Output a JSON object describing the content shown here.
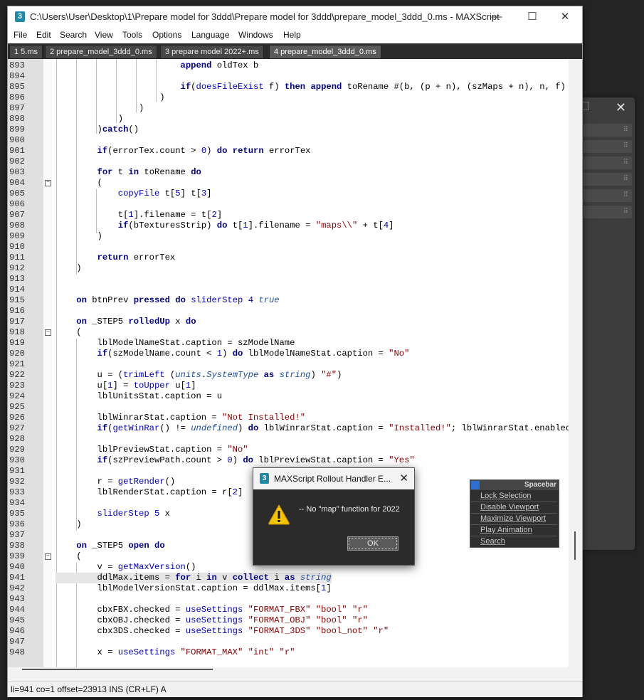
{
  "window": {
    "title": "C:\\Users\\User\\Desktop\\1\\Prepare model for 3ddd\\Prepare model for 3ddd\\prepare_model_3ddd_0.ms - MAXScript",
    "icon_label": "3",
    "minimize": "—",
    "maximize": "☐",
    "close": "✕"
  },
  "menu": [
    "File",
    "Edit",
    "Search",
    "View",
    "Tools",
    "Options",
    "Language",
    "Windows",
    "Help"
  ],
  "tabs": [
    {
      "label": "1 5.ms",
      "active": false
    },
    {
      "label": "2 prepare_model_3ddd_0.ms",
      "active": false
    },
    {
      "label": "3 prepare model 2022+.ms",
      "active": false
    },
    {
      "label": "4 prepare_model_3ddd_0.ms",
      "active": true
    }
  ],
  "code_lines": [
    {
      "n": "893",
      "text": "                        append oldTex b"
    },
    {
      "n": "894",
      "text": ""
    },
    {
      "n": "895",
      "text": "                        if(doesFileExist f) then append toRename #(b, (p + n), (szMaps + n), n, f) else"
    },
    {
      "n": "896",
      "text": "                    )"
    },
    {
      "n": "897",
      "text": "                )"
    },
    {
      "n": "898",
      "text": "            )"
    },
    {
      "n": "899",
      "text": "        )catch()"
    },
    {
      "n": "900",
      "text": ""
    },
    {
      "n": "901",
      "text": "        if(errorTex.count > 0) do return errorTex"
    },
    {
      "n": "902",
      "text": ""
    },
    {
      "n": "903",
      "text": "        for t in toRename do"
    },
    {
      "n": "904",
      "text": "        ("
    },
    {
      "n": "905",
      "text": "            copyFile t[5] t[3]"
    },
    {
      "n": "906",
      "text": ""
    },
    {
      "n": "907",
      "text": "            t[1].filename = t[2]"
    },
    {
      "n": "908",
      "text": "            if(bTexturesStrip) do t[1].filename = \"maps\\\\\" + t[4]"
    },
    {
      "n": "909",
      "text": "        )"
    },
    {
      "n": "910",
      "text": ""
    },
    {
      "n": "911",
      "text": "        return errorTex"
    },
    {
      "n": "912",
      "text": "    )"
    },
    {
      "n": "913",
      "text": ""
    },
    {
      "n": "914",
      "text": ""
    },
    {
      "n": "915",
      "text": "    on btnPrev pressed do sliderStep 4 true"
    },
    {
      "n": "916",
      "text": ""
    },
    {
      "n": "917",
      "text": "    on _STEP5 rolledUp x do"
    },
    {
      "n": "918",
      "text": "    ("
    },
    {
      "n": "919",
      "text": "        lblModelNameStat.caption = szModelName"
    },
    {
      "n": "920",
      "text": "        if(szModelName.count < 1) do lblModelNameStat.caption = \"No\""
    },
    {
      "n": "921",
      "text": ""
    },
    {
      "n": "922",
      "text": "        u = (trimLeft (units.SystemType as string) \"#\")"
    },
    {
      "n": "923",
      "text": "        u[1] = toUpper u[1]"
    },
    {
      "n": "924",
      "text": "        lblUnitsStat.caption = u"
    },
    {
      "n": "925",
      "text": ""
    },
    {
      "n": "926",
      "text": "        lblWinrarStat.caption = \"Not Installed!\""
    },
    {
      "n": "927",
      "text": "        if(getWinRar() != undefined) do lblWinrarStat.caption = \"Installed!\"; lblWinrarStat.enabled = t"
    },
    {
      "n": "928",
      "text": ""
    },
    {
      "n": "929",
      "text": "        lblPreviewStat.caption = \"No\""
    },
    {
      "n": "930",
      "text": "        if(szPreviewPath.count > 0) do lblPreviewStat.caption = \"Yes\""
    },
    {
      "n": "931",
      "text": ""
    },
    {
      "n": "932",
      "text": "        r = getRender()"
    },
    {
      "n": "933",
      "text": "        lblRenderStat.caption = r[2]"
    },
    {
      "n": "934",
      "text": ""
    },
    {
      "n": "935",
      "text": "        sliderStep 5 x"
    },
    {
      "n": "936",
      "text": "    )"
    },
    {
      "n": "937",
      "text": ""
    },
    {
      "n": "938",
      "text": "    on _STEP5 open do"
    },
    {
      "n": "939",
      "text": "    ("
    },
    {
      "n": "940",
      "text": "        v = getMaxVersion()"
    },
    {
      "n": "941",
      "text": "        ddlMax.items = for i in v collect i as string"
    },
    {
      "n": "942",
      "text": "        lblModelVersionStat.caption = ddlMax.items[1]"
    },
    {
      "n": "943",
      "text": ""
    },
    {
      "n": "944",
      "text": "        cbxFBX.checked = useSettings \"FORMAT_FBX\" \"bool\" \"r\""
    },
    {
      "n": "945",
      "text": "        cbxOBJ.checked = useSettings \"FORMAT_OBJ\" \"bool\" \"r\""
    },
    {
      "n": "946",
      "text": "        cbx3DS.checked = useSettings \"FORMAT_3DS\" \"bool_not\" \"r\""
    },
    {
      "n": "947",
      "text": ""
    },
    {
      "n": "948",
      "text": "        x = useSettings \"FORMAT_MAX\" \"int\" \"r\""
    }
  ],
  "status": "li=941 co=1 offset=23913 INS (CR+LF) A",
  "dialog": {
    "icon_label": "3",
    "title": "MAXScript Rollout Handler E...",
    "close": "✕",
    "message": "-- No \"map\" function for 2022",
    "ok_label": "OK"
  },
  "spacebar_menu": {
    "title": "Spacebar",
    "items": [
      "Lock Selection",
      "Disable Viewport",
      "Maximize Viewport",
      "Play Animation",
      "Search"
    ]
  },
  "colors": {
    "keyword": "#00008b",
    "string": "#8b0000",
    "function": "#0000cd",
    "current_line": "#e6e6e6",
    "accent": "#2d6fd1"
  }
}
